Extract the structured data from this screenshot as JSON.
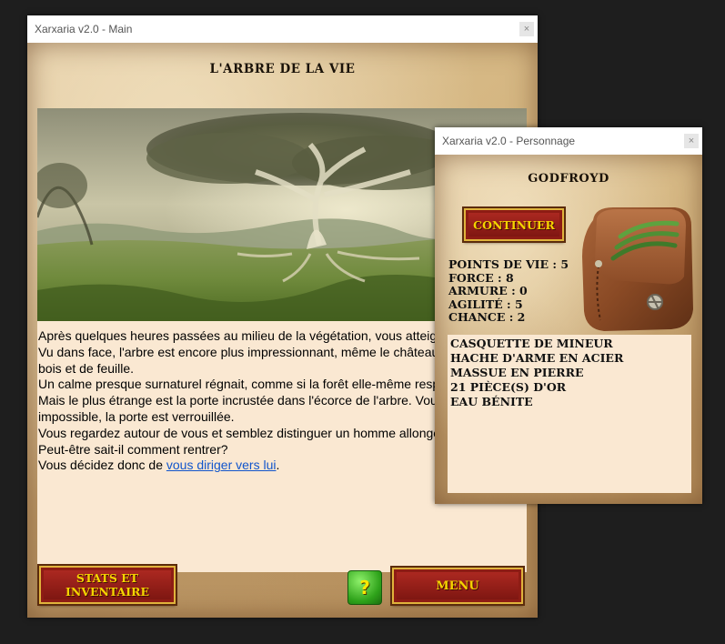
{
  "main_window": {
    "title": "Xarxaria v2.0 - Main",
    "close_symbol": "×",
    "heading": "L'ARBRE DE LA VIE",
    "story_paragraphs": [
      "Après quelques heures passées au milieu de la végétation, vous atteignez votre destination : l'Arbre de la vie.",
      "Vu dans face, l'arbre est encore plus impressionnant, même le château fait pâle figure comparé à ce colosse de bois et de feuille.",
      "Un calme presque surnaturel régnait, comme si la forêt elle-même respectait ce lieu ancestral.",
      "Mais le plus étrange est la porte incrustée dans l'écorce de l'arbre. Vous vous approchez et tentez de l'ouvrir mais impossible, la porte est verrouillée.",
      "Vous regardez autour de vous et semblez distinguer un homme allongé contre un arbre comme s'il dormait.",
      "Peut-être sait-il comment rentrer?"
    ],
    "story_last_prefix": "Vous décidez donc de ",
    "story_link": "vous diriger vers lui",
    "story_last_suffix": ".",
    "buttons": {
      "stats": "STATS ET INVENTAIRE",
      "help": "?",
      "menu": "MENU"
    }
  },
  "character_window": {
    "title": "Xarxaria v2.0 - Personnage",
    "close_symbol": "×",
    "name": "GODFROYD",
    "continue_label": "CONTINUER",
    "stats": [
      "POINTS DE VIE : 5",
      "FORCE : 8",
      "ARMURE : 0",
      "AGILITÉ : 5",
      "CHANCE : 2"
    ],
    "inventory": [
      "CASQUETTE DE MINEUR",
      "HACHE D'ARME EN ACIER",
      "MASSUE EN PIERRE",
      "21 PIÈCE(S) D'OR",
      "EAU BÉNITE"
    ],
    "bag_image": "leather-bag-icon"
  },
  "colors": {
    "button_red": "#9c1f18",
    "button_text": "#f5d400",
    "button_border": "#e0b33c",
    "text_panel": "#fae8d2",
    "help_green": "#2ea21a",
    "link": "#1155cc"
  }
}
